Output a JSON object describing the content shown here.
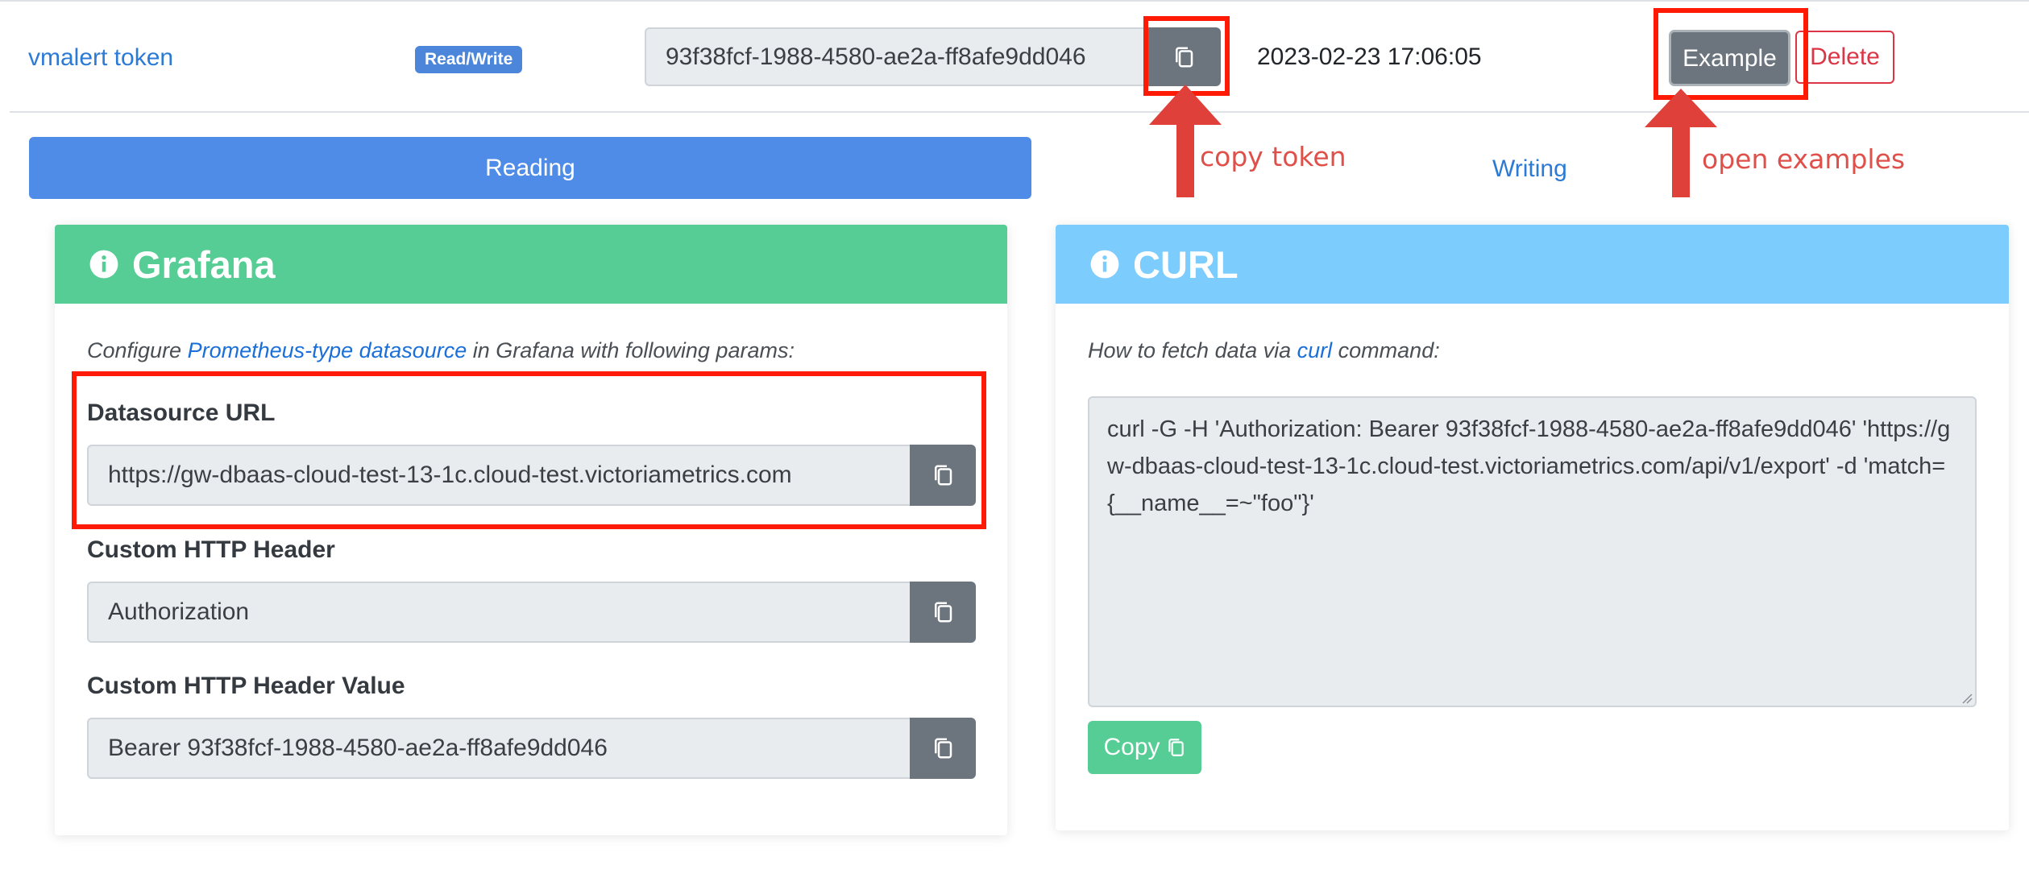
{
  "token_row": {
    "name": "vmalert token",
    "badge": "Read/Write",
    "token": "93f38fcf-1988-4580-ae2a-ff8afe9dd046",
    "date": "2023-02-23 17:06:05",
    "example_label": "Example",
    "delete_label": "Delete"
  },
  "annotations": {
    "copy_token": "copy token",
    "open_examples": "open examples"
  },
  "tabs": {
    "reading": "Reading",
    "writing": "Writing"
  },
  "grafana": {
    "title": "Grafana",
    "hint_prefix": "Configure ",
    "hint_link": "Prometheus-type datasource",
    "hint_suffix": " in Grafana with following params:",
    "fields": [
      {
        "label": "Datasource URL",
        "value": "https://gw-dbaas-cloud-test-13-1c.cloud-test.victoriametrics.com"
      },
      {
        "label": "Custom HTTP Header",
        "value": "Authorization"
      },
      {
        "label": "Custom HTTP Header Value",
        "value": "Bearer 93f38fcf-1988-4580-ae2a-ff8afe9dd046"
      }
    ]
  },
  "curl": {
    "title": "CURL",
    "hint_prefix": "How to fetch data via ",
    "hint_link": "curl",
    "hint_suffix": " command:",
    "command": "curl -G -H 'Authorization: Bearer 93f38fcf-1988-4580-ae2a-ff8afe9dd046' 'https://gw-dbaas-cloud-test-13-1c.cloud-test.victoriametrics.com/api/v1/export' -d 'match={__name__=~\"foo\"}'",
    "copy_label": "Copy"
  },
  "colors": {
    "link": "#2b7ad6",
    "badge": "#4b86db",
    "reading_tab": "#4f8ce8",
    "grafana_header": "#55cd95",
    "curl_header": "#7ccdfd",
    "secondary_button": "#6c757d",
    "danger": "#dc3545",
    "annotation_red": "#ff1a06"
  },
  "icons": {
    "copy": "copy-icon",
    "info": "info-circle-icon",
    "arrow": "arrow-up-icon"
  }
}
